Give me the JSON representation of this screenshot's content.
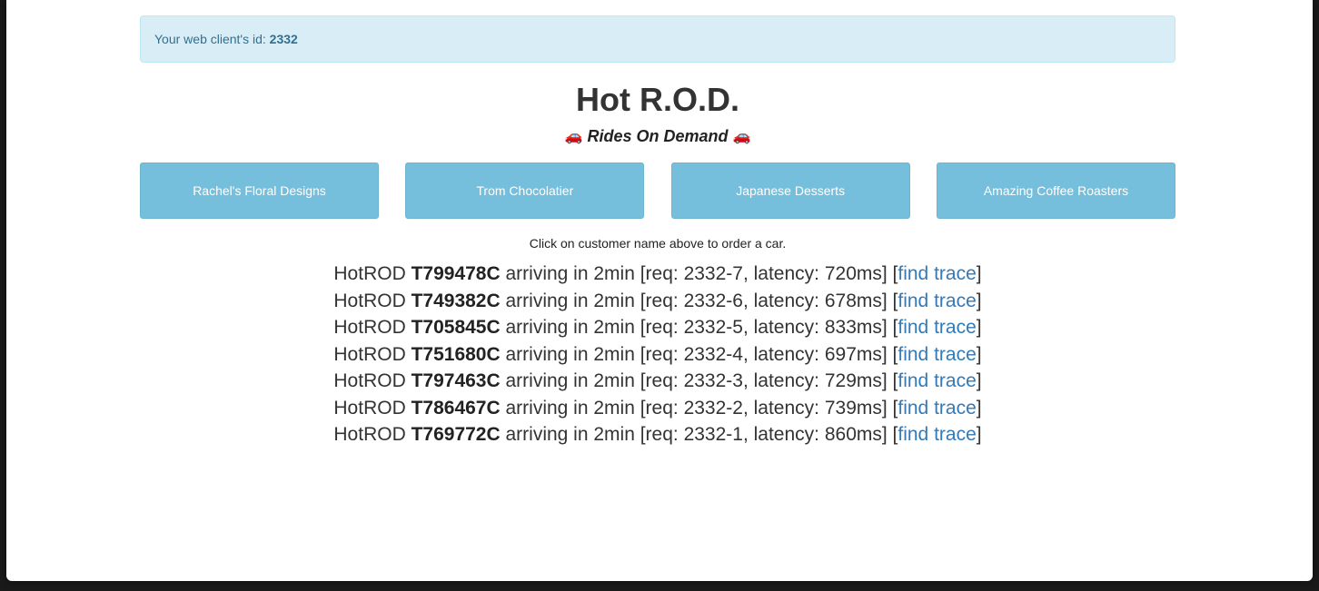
{
  "alert": {
    "prefix": "Your web client's id: ",
    "client_id": "2332"
  },
  "header": {
    "title": "Hot R.O.D.",
    "subtitle": "Rides On Demand",
    "car_glyph": "🚗"
  },
  "customers": [
    {
      "label": "Rachel's Floral Designs"
    },
    {
      "label": "Trom Chocolatier"
    },
    {
      "label": "Japanese Desserts"
    },
    {
      "label": "Amazing Coffee Roasters"
    }
  ],
  "hint": "Click on customer name above to order a car.",
  "rides": [
    {
      "prefix": "HotROD ",
      "car": "T799478C",
      "middle": " arriving in 2min [req: 2332-7, latency: 720ms] [",
      "link": "find trace",
      "suffix": "]"
    },
    {
      "prefix": "HotROD ",
      "car": "T749382C",
      "middle": " arriving in 2min [req: 2332-6, latency: 678ms] [",
      "link": "find trace",
      "suffix": "]"
    },
    {
      "prefix": "HotROD ",
      "car": "T705845C",
      "middle": " arriving in 2min [req: 2332-5, latency: 833ms] [",
      "link": "find trace",
      "suffix": "]"
    },
    {
      "prefix": "HotROD ",
      "car": "T751680C",
      "middle": " arriving in 2min [req: 2332-4, latency: 697ms] [",
      "link": "find trace",
      "suffix": "]"
    },
    {
      "prefix": "HotROD ",
      "car": "T797463C",
      "middle": " arriving in 2min [req: 2332-3, latency: 729ms] [",
      "link": "find trace",
      "suffix": "]"
    },
    {
      "prefix": "HotROD ",
      "car": "T786467C",
      "middle": " arriving in 2min [req: 2332-2, latency: 739ms] [",
      "link": "find trace",
      "suffix": "]"
    },
    {
      "prefix": "HotROD ",
      "car": "T769772C",
      "middle": " arriving in 2min [req: 2332-1, latency: 860ms] [",
      "link": "find trace",
      "suffix": "]"
    }
  ],
  "colors": {
    "alert_bg": "#d9edf7",
    "alert_text": "#31708f",
    "button_bg": "#75bfdc",
    "link": "#337ab7"
  }
}
